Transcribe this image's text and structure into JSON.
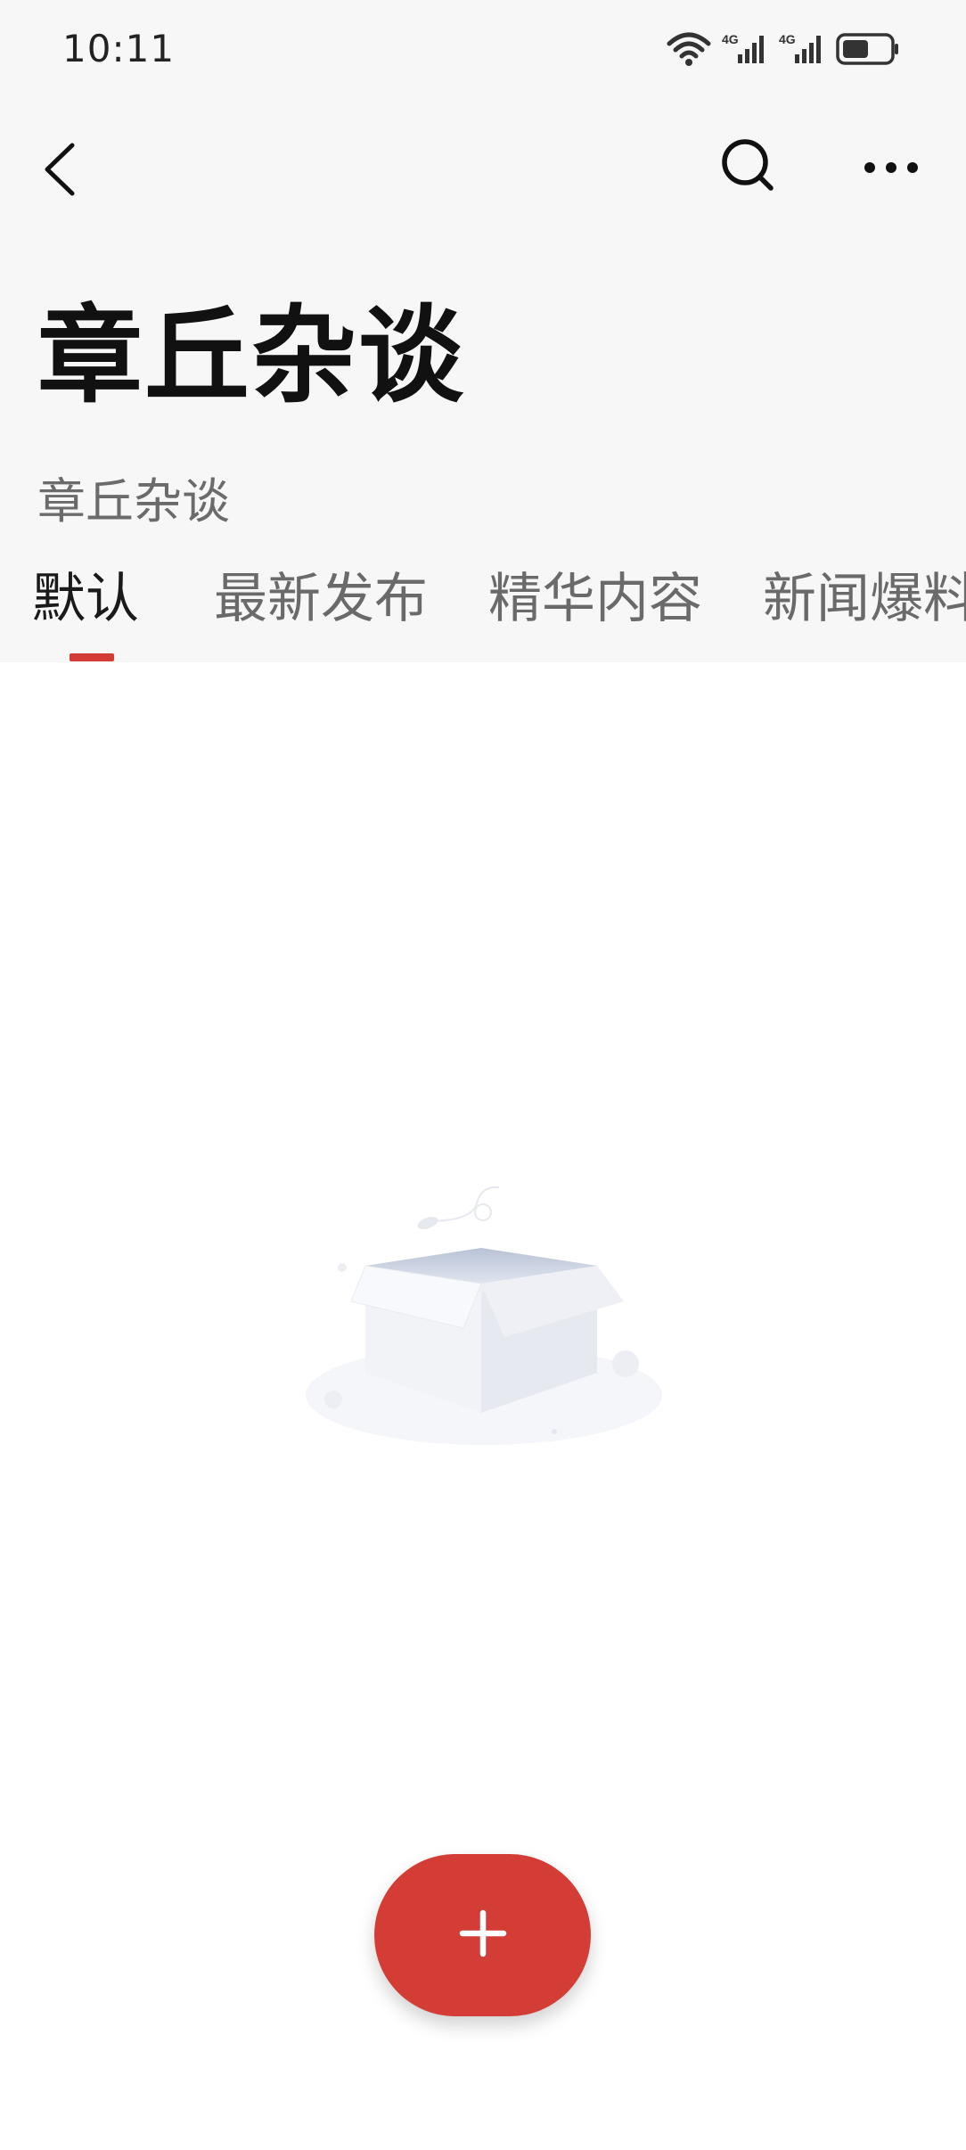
{
  "status_bar": {
    "time": "10:11",
    "network_1": "4G",
    "network_2": "4G"
  },
  "nav": {
    "back_icon": "chevron-left-icon",
    "search_icon": "search-icon",
    "more_icon": "more-horizontal-icon"
  },
  "page": {
    "title": "章丘杂谈",
    "subtitle": "章丘杂谈"
  },
  "tabs": [
    {
      "label": "默认",
      "active": true
    },
    {
      "label": "最新发布",
      "active": false
    },
    {
      "label": "精华内容",
      "active": false
    },
    {
      "label": "新闻爆料",
      "active": false
    }
  ],
  "empty_state": {
    "illustration": "empty-box-illustration"
  },
  "fab": {
    "icon": "plus-icon"
  },
  "colors": {
    "accent": "#d33d35",
    "header_bg": "#f7f7f7"
  }
}
